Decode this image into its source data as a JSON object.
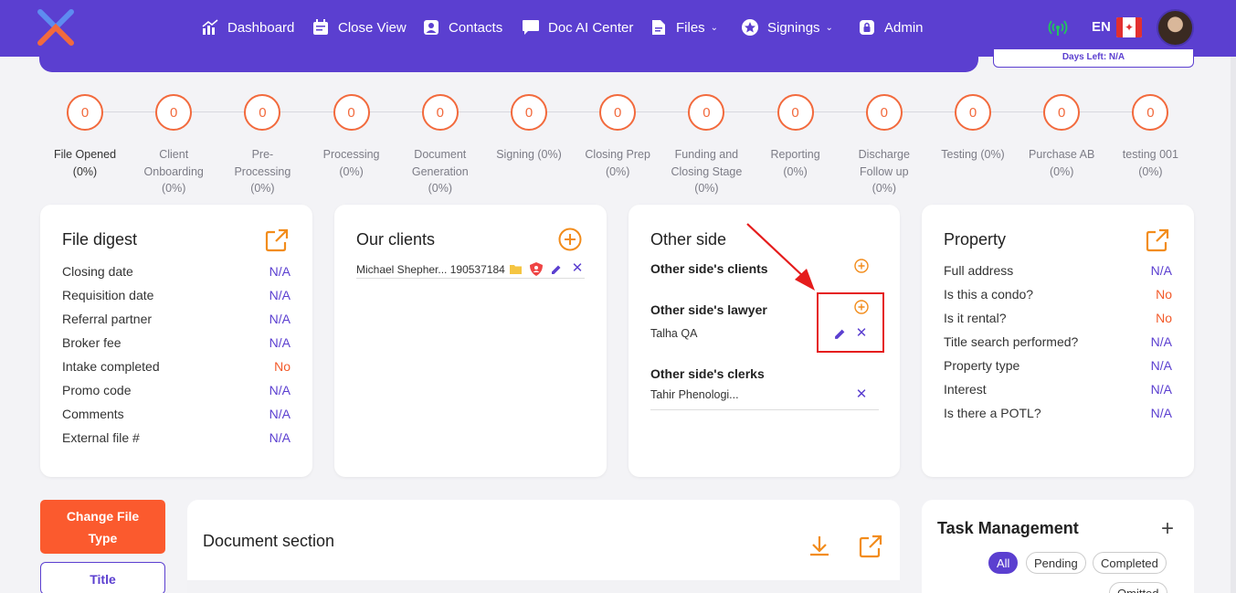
{
  "nav": {
    "items": [
      {
        "label": "Dashboard",
        "icon": "chart-icon"
      },
      {
        "label": "Close View",
        "icon": "calendar-icon"
      },
      {
        "label": "Contacts",
        "icon": "contact-icon"
      },
      {
        "label": "Doc AI Center",
        "icon": "chat-icon"
      },
      {
        "label": "Files",
        "icon": "file-icon"
      },
      {
        "label": "Signings",
        "icon": "star-icon"
      },
      {
        "label": "Admin",
        "icon": "lock-icon"
      }
    ],
    "lang": "EN",
    "flag_symbol": "✦"
  },
  "days_left": "Days Left: N/A",
  "stages": [
    {
      "count": "0",
      "label1": "File Opened",
      "label2": "(0%)",
      "label3": ""
    },
    {
      "count": "0",
      "label1": "Client",
      "label2": "Onboarding",
      "label3": "(0%)"
    },
    {
      "count": "0",
      "label1": "Pre-",
      "label2": "Processing",
      "label3": "(0%)"
    },
    {
      "count": "0",
      "label1": "Processing",
      "label2": "(0%)",
      "label3": ""
    },
    {
      "count": "0",
      "label1": "Document",
      "label2": "Generation",
      "label3": "(0%)"
    },
    {
      "count": "0",
      "label1": "Signing (0%)",
      "label2": "",
      "label3": ""
    },
    {
      "count": "0",
      "label1": "Closing Prep",
      "label2": "(0%)",
      "label3": ""
    },
    {
      "count": "0",
      "label1": "Funding and",
      "label2": "Closing Stage",
      "label3": "(0%)"
    },
    {
      "count": "0",
      "label1": "Reporting",
      "label2": "(0%)",
      "label3": ""
    },
    {
      "count": "0",
      "label1": "Discharge",
      "label2": "Follow up",
      "label3": "(0%)"
    },
    {
      "count": "0",
      "label1": "Testing (0%)",
      "label2": "",
      "label3": ""
    },
    {
      "count": "0",
      "label1": "Purchase AB",
      "label2": "(0%)",
      "label3": ""
    },
    {
      "count": "0",
      "label1": "testing 001",
      "label2": "(0%)",
      "label3": ""
    }
  ],
  "file_digest": {
    "title": "File digest",
    "rows": [
      {
        "label": "Closing date",
        "value": "N/A"
      },
      {
        "label": "Requisition date",
        "value": "N/A"
      },
      {
        "label": "Referral partner",
        "value": "N/A"
      },
      {
        "label": "Broker fee",
        "value": "N/A"
      },
      {
        "label": "Intake completed",
        "value": "No"
      },
      {
        "label": "Promo code",
        "value": "N/A"
      },
      {
        "label": "Comments",
        "value": "N/A"
      },
      {
        "label": "External file #",
        "value": "N/A"
      }
    ]
  },
  "our_clients": {
    "title": "Our clients",
    "client": "Michael Shepher... 190537184"
  },
  "other_side": {
    "title": "Other side",
    "clients_label": "Other side's clients",
    "lawyer_label": "Other side's lawyer",
    "lawyer_name": "Talha QA",
    "clerks_label": "Other side's clerks",
    "clerk_name": "Tahir Phenologi..."
  },
  "property": {
    "title": "Property",
    "rows": [
      {
        "label": "Full address",
        "value": "N/A"
      },
      {
        "label": "Is this a condo?",
        "value": "No"
      },
      {
        "label": "Is it rental?",
        "value": "No"
      },
      {
        "label": "Title search performed?",
        "value": "N/A"
      },
      {
        "label": "Property type",
        "value": "N/A"
      },
      {
        "label": "Interest",
        "value": "N/A"
      },
      {
        "label": "Is there a POTL?",
        "value": "N/A"
      }
    ]
  },
  "change_file_type": {
    "line1": "Change File",
    "line2": "Type"
  },
  "title_button": "Title",
  "document_section": {
    "title": "Document section"
  },
  "task_management": {
    "title": "Task Management",
    "plus": "+",
    "filters": [
      "All",
      "Pending",
      "Completed",
      "Omitted"
    ]
  },
  "colors": {
    "brand": "#5b3fd0",
    "accent": "#f26a3d",
    "danger": "#f25a2a",
    "highlight": "#e51c1c"
  }
}
